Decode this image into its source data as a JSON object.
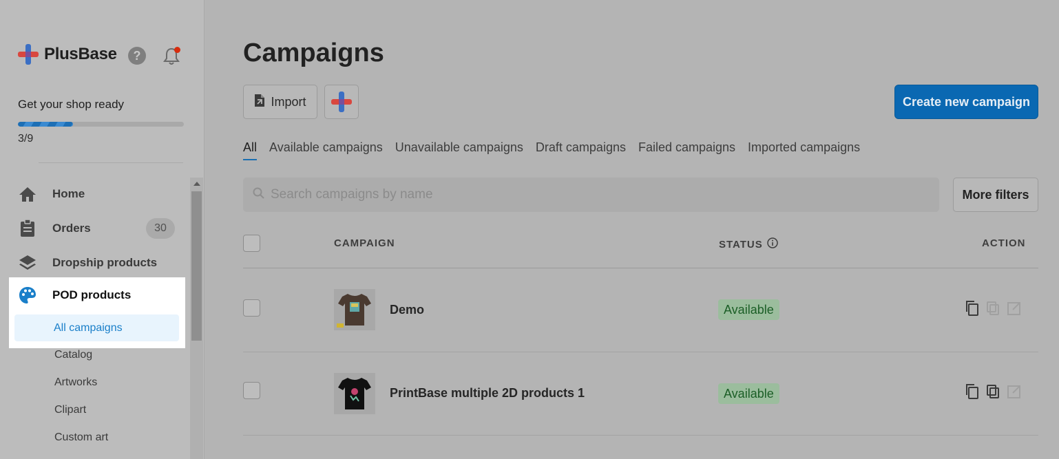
{
  "sidebar": {
    "brand": "PlusBase",
    "help_glyph": "?",
    "shop_ready": "Get your shop ready",
    "progress_fraction": 0.33,
    "progress_label": "3/9",
    "nav": [
      {
        "label": "Home",
        "icon": "home-icon"
      },
      {
        "label": "Orders",
        "icon": "clipboard-icon",
        "badge": "30"
      },
      {
        "label": "Dropship products",
        "icon": "layers-icon"
      }
    ],
    "pod": {
      "label": "POD products",
      "icon": "palette-icon",
      "active_sub": "All campaigns",
      "subs": [
        "Catalog",
        "Artworks",
        "Clipart",
        "Custom art"
      ]
    }
  },
  "main": {
    "title": "Campaigns",
    "import_label": "Import",
    "create_label": "Create new campaign",
    "tabs": [
      "All",
      "Available campaigns",
      "Unavailable campaigns",
      "Draft campaigns",
      "Failed campaigns",
      "Imported campaigns"
    ],
    "search_placeholder": "Search campaigns by name",
    "filters_label": "More filters",
    "table": {
      "col_campaign": "CAMPAIGN",
      "col_status": "STATUS",
      "col_action": "ACTION",
      "rows": [
        {
          "name": "Demo",
          "status": "Available",
          "thumb": "brown-tshirt"
        },
        {
          "name": "PrintBase multiple 2D products 1",
          "status": "Available",
          "thumb": "black-tshirt"
        }
      ]
    }
  },
  "colors": {
    "accent": "#0a68b2",
    "active_link": "#1a7fc9",
    "status_ok_bg": "#9bbd9d",
    "logo_red": "#d9473f",
    "logo_blue": "#3b6fc4"
  }
}
